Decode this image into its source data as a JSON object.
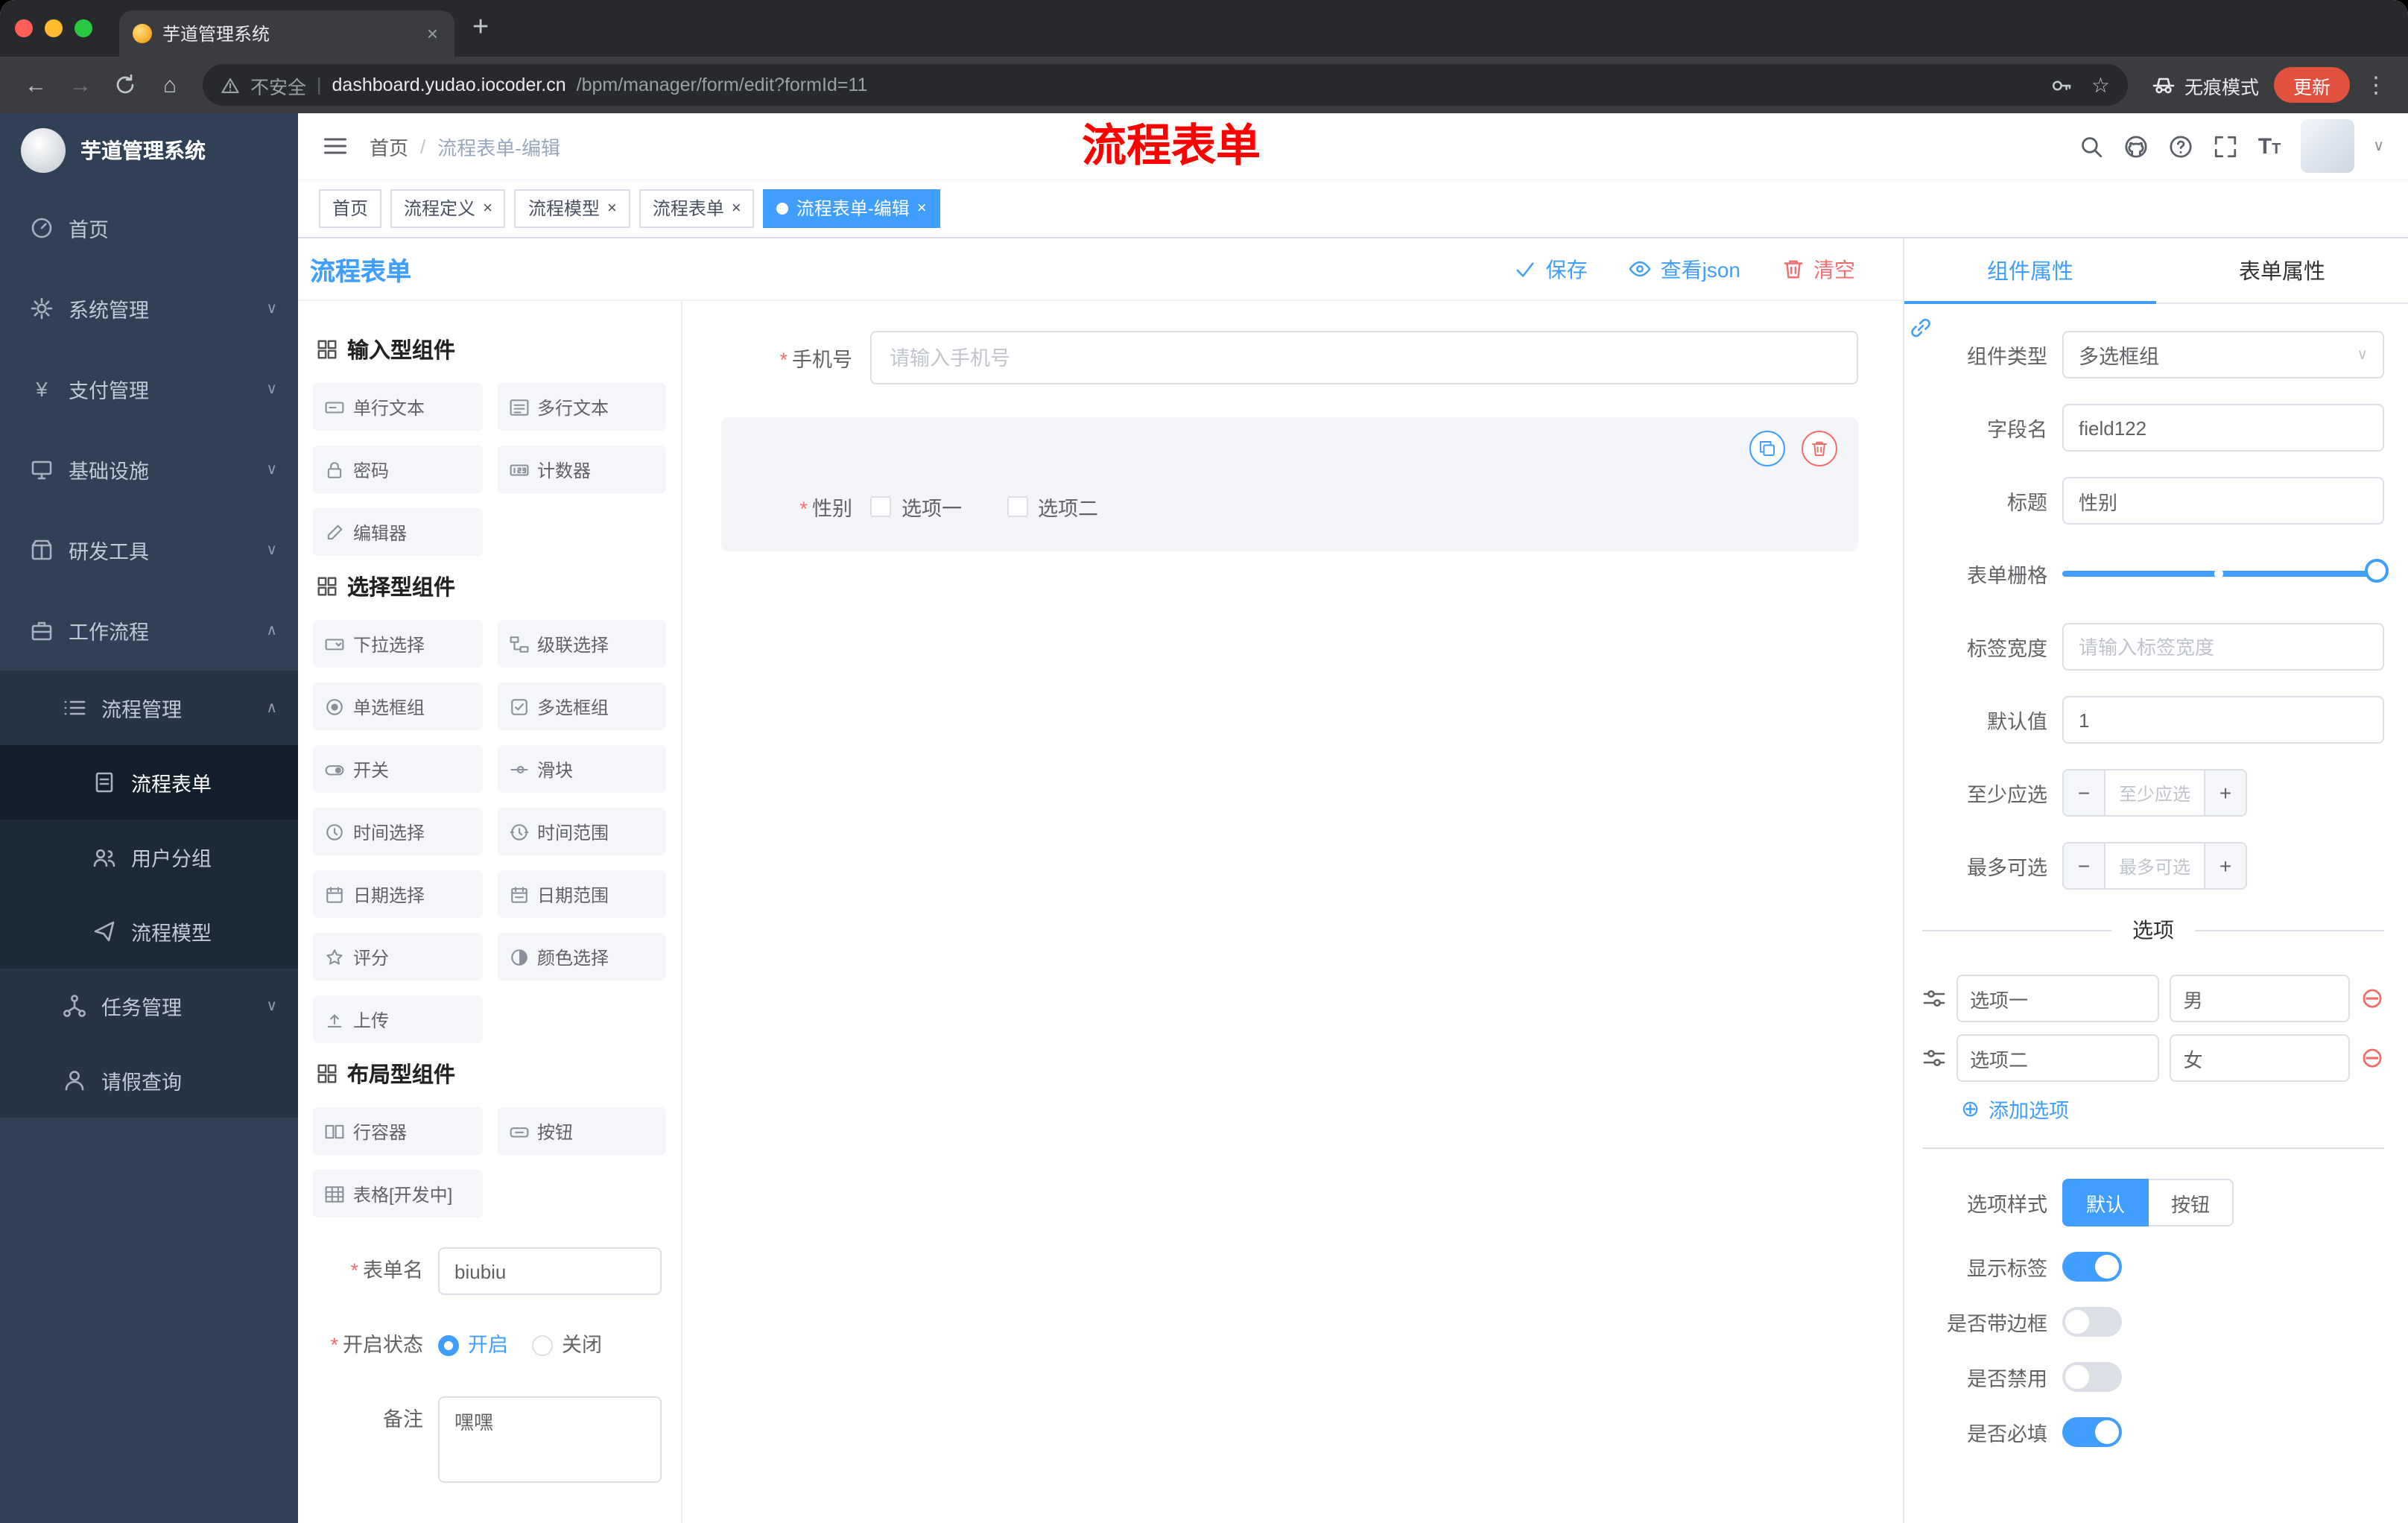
{
  "colors": {
    "accent": "#409eff",
    "danger": "#f56c6c",
    "annotation_red": "#ff0000",
    "sidebar_bg": "#304156"
  },
  "browser": {
    "tab_title": "芋道管理系统",
    "security_label": "不安全",
    "url_domain": "dashboard.yudao.iocoder.cn",
    "url_path": "/bpm/manager/form/edit?formId=11",
    "incognito_label": "无痕模式",
    "update_label": "更新"
  },
  "annotation": "流程表单",
  "sidebar": {
    "logo_title": "芋道管理系统",
    "items": [
      {
        "label": "首页"
      },
      {
        "label": "系统管理"
      },
      {
        "label": "支付管理"
      },
      {
        "label": "基础设施"
      },
      {
        "label": "研发工具"
      },
      {
        "label": "工作流程"
      },
      {
        "label": "流程管理"
      },
      {
        "label": "流程表单"
      },
      {
        "label": "用户分组"
      },
      {
        "label": "流程模型"
      },
      {
        "label": "任务管理"
      },
      {
        "label": "请假查询"
      }
    ]
  },
  "header": {
    "breadcrumb_home": "首页",
    "breadcrumb_current": "流程表单-编辑"
  },
  "tags": [
    {
      "label": "首页"
    },
    {
      "label": "流程定义"
    },
    {
      "label": "流程模型"
    },
    {
      "label": "流程表单"
    },
    {
      "label": "流程表单-编辑"
    }
  ],
  "toolbar": {
    "title": "流程表单",
    "save": "保存",
    "view_json": "查看json",
    "clear": "清空"
  },
  "palette": {
    "sections": [
      {
        "title": "输入型组件",
        "items": [
          "单行文本",
          "多行文本",
          "密码",
          "计数器",
          "编辑器"
        ]
      },
      {
        "title": "选择型组件",
        "items": [
          "下拉选择",
          "级联选择",
          "单选框组",
          "多选框组",
          "开关",
          "滑块",
          "时间选择",
          "时间范围",
          "日期选择",
          "日期范围",
          "评分",
          "颜色选择",
          "上传"
        ]
      },
      {
        "title": "布局型组件",
        "items": [
          "行容器",
          "按钮",
          "表格[开发中]"
        ]
      }
    ]
  },
  "form_meta": {
    "name_label": "表单名",
    "name_value": "biubiu",
    "status_label": "开启状态",
    "status_on": "开启",
    "status_off": "关闭",
    "remark_label": "备注",
    "remark_value": "嘿嘿"
  },
  "canvas": {
    "phone": {
      "label": "手机号",
      "placeholder": "请输入手机号"
    },
    "gender": {
      "label": "性别",
      "option1": "选项一",
      "option2": "选项二"
    }
  },
  "props": {
    "tab_component": "组件属性",
    "tab_form": "表单属性",
    "component_type_label": "组件类型",
    "component_type_value": "多选框组",
    "field_label": "字段名",
    "field_value": "field122",
    "title_label": "标题",
    "title_value": "性别",
    "grid_label": "表单栅格",
    "label_width_label": "标签宽度",
    "label_width_placeholder": "请输入标签宽度",
    "default_label": "默认值",
    "default_value": "1",
    "min_label": "至少应选",
    "min_placeholder": "至少应选",
    "max_label": "最多可选",
    "max_placeholder": "最多可选",
    "options_title": "选项",
    "option1_label": "选项一",
    "option1_value": "男",
    "option2_label": "选项二",
    "option2_value": "女",
    "add_option": "添加选项",
    "style_label": "选项样式",
    "style_default": "默认",
    "style_button": "按钮",
    "switch_show_label": "显示标签",
    "switch_border": "是否带边框",
    "switch_disabled": "是否禁用",
    "switch_required": "是否必填"
  }
}
